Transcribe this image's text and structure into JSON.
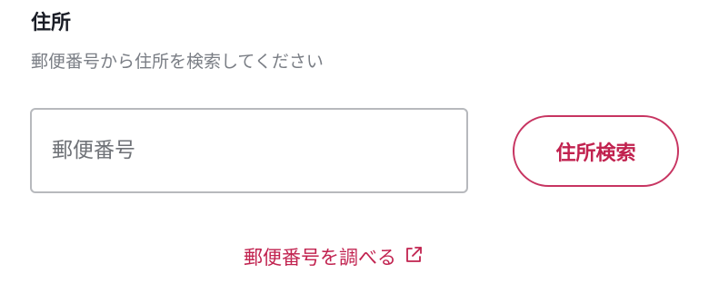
{
  "section": {
    "title": "住所",
    "hint": "郵便番号から住所を検索してください"
  },
  "postal_code": {
    "value": "",
    "placeholder": "郵便番号"
  },
  "search_button": {
    "label": "住所検索"
  },
  "lookup_link": {
    "label": "郵便番号を調べる",
    "icon": "external-link-icon"
  },
  "colors": {
    "accent": "#c1224f",
    "input_border": "#b7b9bd",
    "hint_text": "#7a7e85",
    "title_text": "#1a1d26"
  }
}
